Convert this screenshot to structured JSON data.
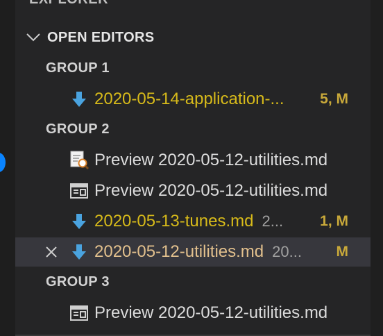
{
  "explorer_title": "EXPLORER",
  "section": {
    "title": "OPEN EDITORS"
  },
  "groups": [
    {
      "label": "GROUP 1",
      "items": [
        {
          "icon": "arrow-down-icon",
          "label": "2020-05-14-application-...",
          "description": "",
          "badge": "5, M"
        }
      ]
    },
    {
      "label": "GROUP 2",
      "items": [
        {
          "icon": "preview-search-icon",
          "label": "Preview 2020-05-12-utilities.md",
          "description": "",
          "badge": ""
        },
        {
          "icon": "preview-icon",
          "label": "Preview 2020-05-12-utilities.md",
          "description": "",
          "badge": ""
        },
        {
          "icon": "arrow-down-icon",
          "label": "2020-05-13-tunes.md",
          "description": "2...",
          "badge": "1, M"
        },
        {
          "icon": "arrow-down-icon",
          "label": "2020-05-12-utilities.md",
          "description": "20...",
          "badge": "M",
          "selected": true
        }
      ]
    },
    {
      "label": "GROUP 3",
      "items": [
        {
          "icon": "preview-icon",
          "label": "Preview 2020-05-12-utilities.md",
          "description": "",
          "badge": ""
        }
      ]
    }
  ],
  "colors": {
    "background": "#252526",
    "selected_row": "#37373d",
    "modified_text": "#e2c08d",
    "accent_arrow": "#4aa3df",
    "badge": "#c9a93a"
  }
}
